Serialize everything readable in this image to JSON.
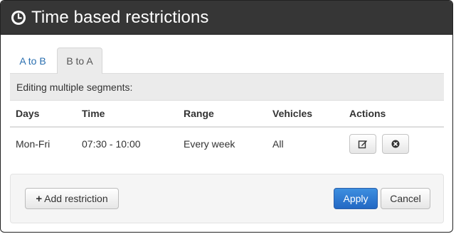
{
  "dialog": {
    "title": "Time based restrictions",
    "icon": "clock-icon"
  },
  "tabs": [
    {
      "label": "A to B",
      "active": false
    },
    {
      "label": "B to A",
      "active": true
    }
  ],
  "panel": {
    "heading": "Editing multiple segments:"
  },
  "table": {
    "headers": [
      "Days",
      "Time",
      "Range",
      "Vehicles",
      "Actions"
    ],
    "rows": [
      {
        "days": "Mon-Fri",
        "time": "07:30 - 10:00",
        "range": "Every week",
        "vehicles": "All",
        "actions": [
          "edit-icon",
          "remove-icon"
        ]
      }
    ]
  },
  "footer": {
    "add_label": "Add restriction",
    "apply_label": "Apply",
    "cancel_label": "Cancel"
  },
  "colors": {
    "titlebar": "#363636",
    "primary": "#2a6fc4",
    "tab_link": "#2a6fb0"
  }
}
